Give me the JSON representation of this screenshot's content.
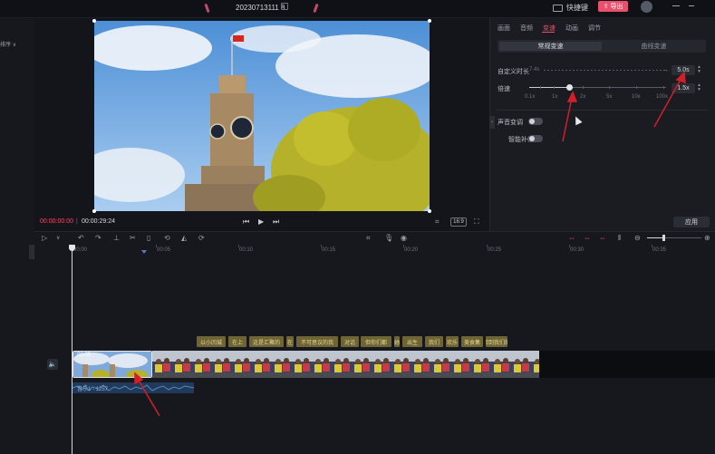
{
  "top_bar": {
    "project_name": "20230713111 8",
    "shortcut_label": "快捷键",
    "export_label": "导出"
  },
  "left_panel": {
    "label": "排序 ∨"
  },
  "player": {
    "current_time": "00:00:00:00",
    "total_time": "00:00:29:24",
    "ratio": "16:9"
  },
  "right_panel": {
    "tabs": [
      "画面",
      "音频",
      "变速",
      "动画",
      "调节",
      "美颜"
    ],
    "active_tab": "变速",
    "segments": [
      "常规变速",
      "曲线变速"
    ],
    "duration": {
      "label": "自定义时长",
      "original": "7.4s",
      "value": "5.0s"
    },
    "speed": {
      "label": "倍速",
      "value": "1.5x",
      "ticks": [
        "0.1x",
        "1x",
        "2x",
        "5x",
        "10x",
        "100x"
      ]
    },
    "toggles": [
      {
        "label": "声音变调",
        "state": false
      },
      {
        "label": "智能补帧",
        "state": false
      }
    ],
    "apply_label": "应用"
  },
  "timeline": {
    "ruler": [
      "00:00",
      "00:05",
      "00:10",
      "00:15",
      "00:20",
      "00:25",
      "00:30",
      "00:35"
    ],
    "captions": [
      "以小凹城",
      "在上",
      "这是汇聚的",
      "在",
      "不可思议的我",
      "对话",
      "但你们都",
      "她",
      "出生",
      "我们",
      "欢乐",
      "美食集",
      "回到我们的"
    ],
    "clip1_time": "00:05",
    "audio_label": "音乐1 - 1257"
  },
  "colors": {
    "accent": "#e9506c",
    "caption_bg": "#6e6434",
    "annotation": "#d11f2a"
  }
}
